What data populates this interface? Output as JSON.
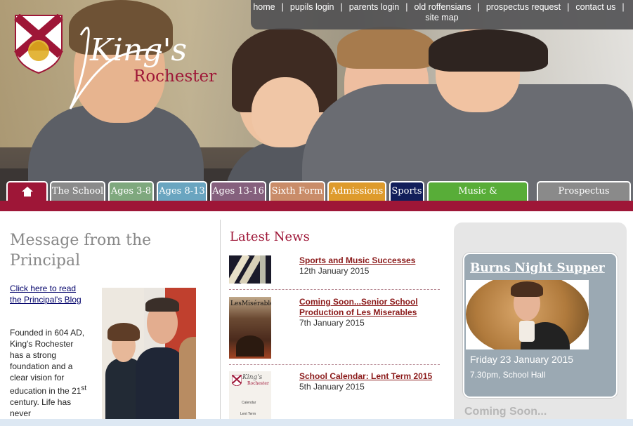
{
  "brand": {
    "name_script": "King's",
    "name_sub": "Rochester"
  },
  "topnav": {
    "items": [
      "home",
      "pupils login",
      "parents login",
      "old roffensians",
      "prospectus request",
      "contact us"
    ],
    "second_row": "site map",
    "separator": "|"
  },
  "tabs": [
    {
      "label": "The School",
      "color": "#8a8a8a"
    },
    {
      "label": "Ages 3-8",
      "color": "#7fa87e"
    },
    {
      "label": "Ages 8-13",
      "color": "#6aa5c0"
    },
    {
      "label": "Ages 13-16",
      "color": "#85607d"
    },
    {
      "label": "Sixth Form",
      "color": "#c98c69"
    },
    {
      "label": "Admissions",
      "color": "#de9b2c"
    },
    {
      "label": "Sports",
      "color": "#121e5a"
    },
    {
      "label": "Music & Performance",
      "color": "#58ad38"
    },
    {
      "label": "Prospectus Request",
      "color": "#8a8a8a"
    }
  ],
  "home_tab": {
    "icon": "home-icon",
    "color": "#9e1637"
  },
  "principal": {
    "heading": "Message from the Principal",
    "blog_link": "Click here to read the Principal's Blog",
    "intro_a": "Founded in 604 AD, King's Rochester has a strong foundation and a clear vision for education in the 21",
    "intro_sup": "st",
    "intro_b": " century. Life has never"
  },
  "news": {
    "heading": "Latest News",
    "items": [
      {
        "title": "Sports and Music Successes",
        "date": "12th January 2015"
      },
      {
        "title": "Coming Soon...Senior School Production of Les Miserables",
        "date": "7th January 2015",
        "thumb_text": "LesMisérables"
      },
      {
        "title": "School Calendar: Lent Term 2015",
        "date": "5th January 2015",
        "thumb_text_a": "King's",
        "thumb_text_b": "Rochester",
        "thumb_text_c": "Calendar",
        "thumb_text_d": "Lent Term"
      }
    ]
  },
  "event": {
    "title": "Burns Night Supper",
    "date": "Friday 23 January 2015",
    "time": "7.30pm, School Hall"
  },
  "coming_soon": "Coming Soon...",
  "colors": {
    "accent": "#9e1637",
    "event_bg": "#9ba9b3",
    "sidebar_bg": "#e6e6e6"
  }
}
